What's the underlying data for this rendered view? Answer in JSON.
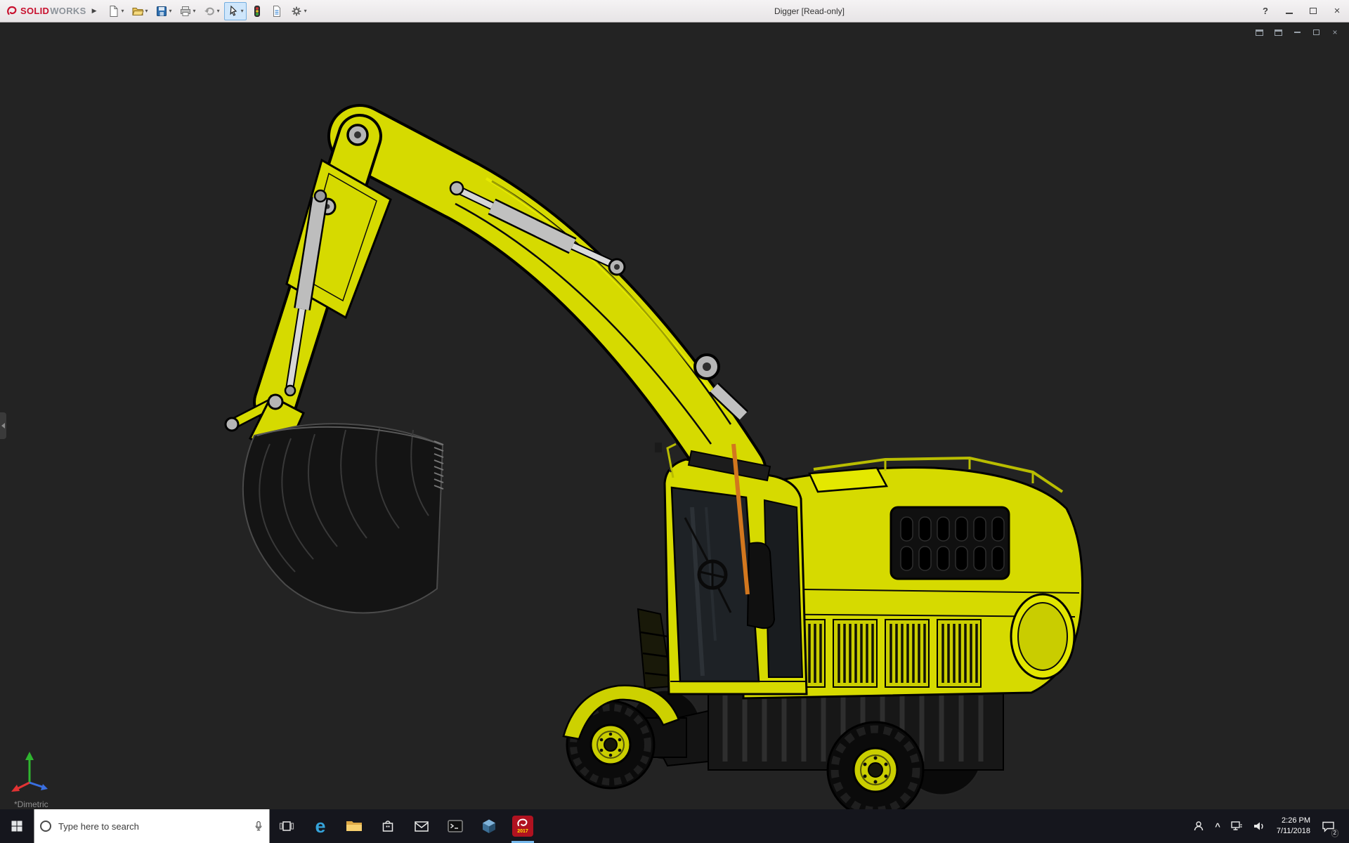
{
  "colors": {
    "titlebar_bg": "#eceaeb",
    "viewport_bg": "#232323",
    "taskbar_bg": "#15161d",
    "machine_yellow": "#d6da00",
    "brand_red": "#c8102e",
    "active_app_accent": "#76b9ed",
    "search_bg": "#ffffff",
    "warning_stripe_orange": "#d2771e"
  },
  "glyphs": {
    "dropdown": "▾",
    "menu_expand": "▶",
    "help": "?",
    "close": "×",
    "edge": "e",
    "tray_chevron": "^"
  },
  "titlebar": {
    "brand": {
      "solid": "SOLID",
      "works": "WORKS"
    },
    "title": "Digger [Read-only]",
    "tools": [
      "new-document",
      "open",
      "save",
      "print",
      "undo",
      "select",
      "rebuild",
      "file-properties",
      "options"
    ]
  },
  "viewport": {
    "view_label": "*Dimetric",
    "doc_controls": [
      "pane",
      "pane",
      "minimize",
      "restore",
      "close"
    ],
    "model": "yellow wheeled excavator (Digger assembly), dimetric view"
  },
  "taskbar": {
    "search_placeholder": "Type here to search",
    "apps": [
      "task-view",
      "edge",
      "file-explorer",
      "store",
      "mail",
      "command-prompt",
      "edrawings",
      "solidworks-2017"
    ],
    "solidworks_year": "2017",
    "tray": {
      "time": "2:26 PM",
      "date": "7/11/2018",
      "notification_count": "2"
    }
  }
}
